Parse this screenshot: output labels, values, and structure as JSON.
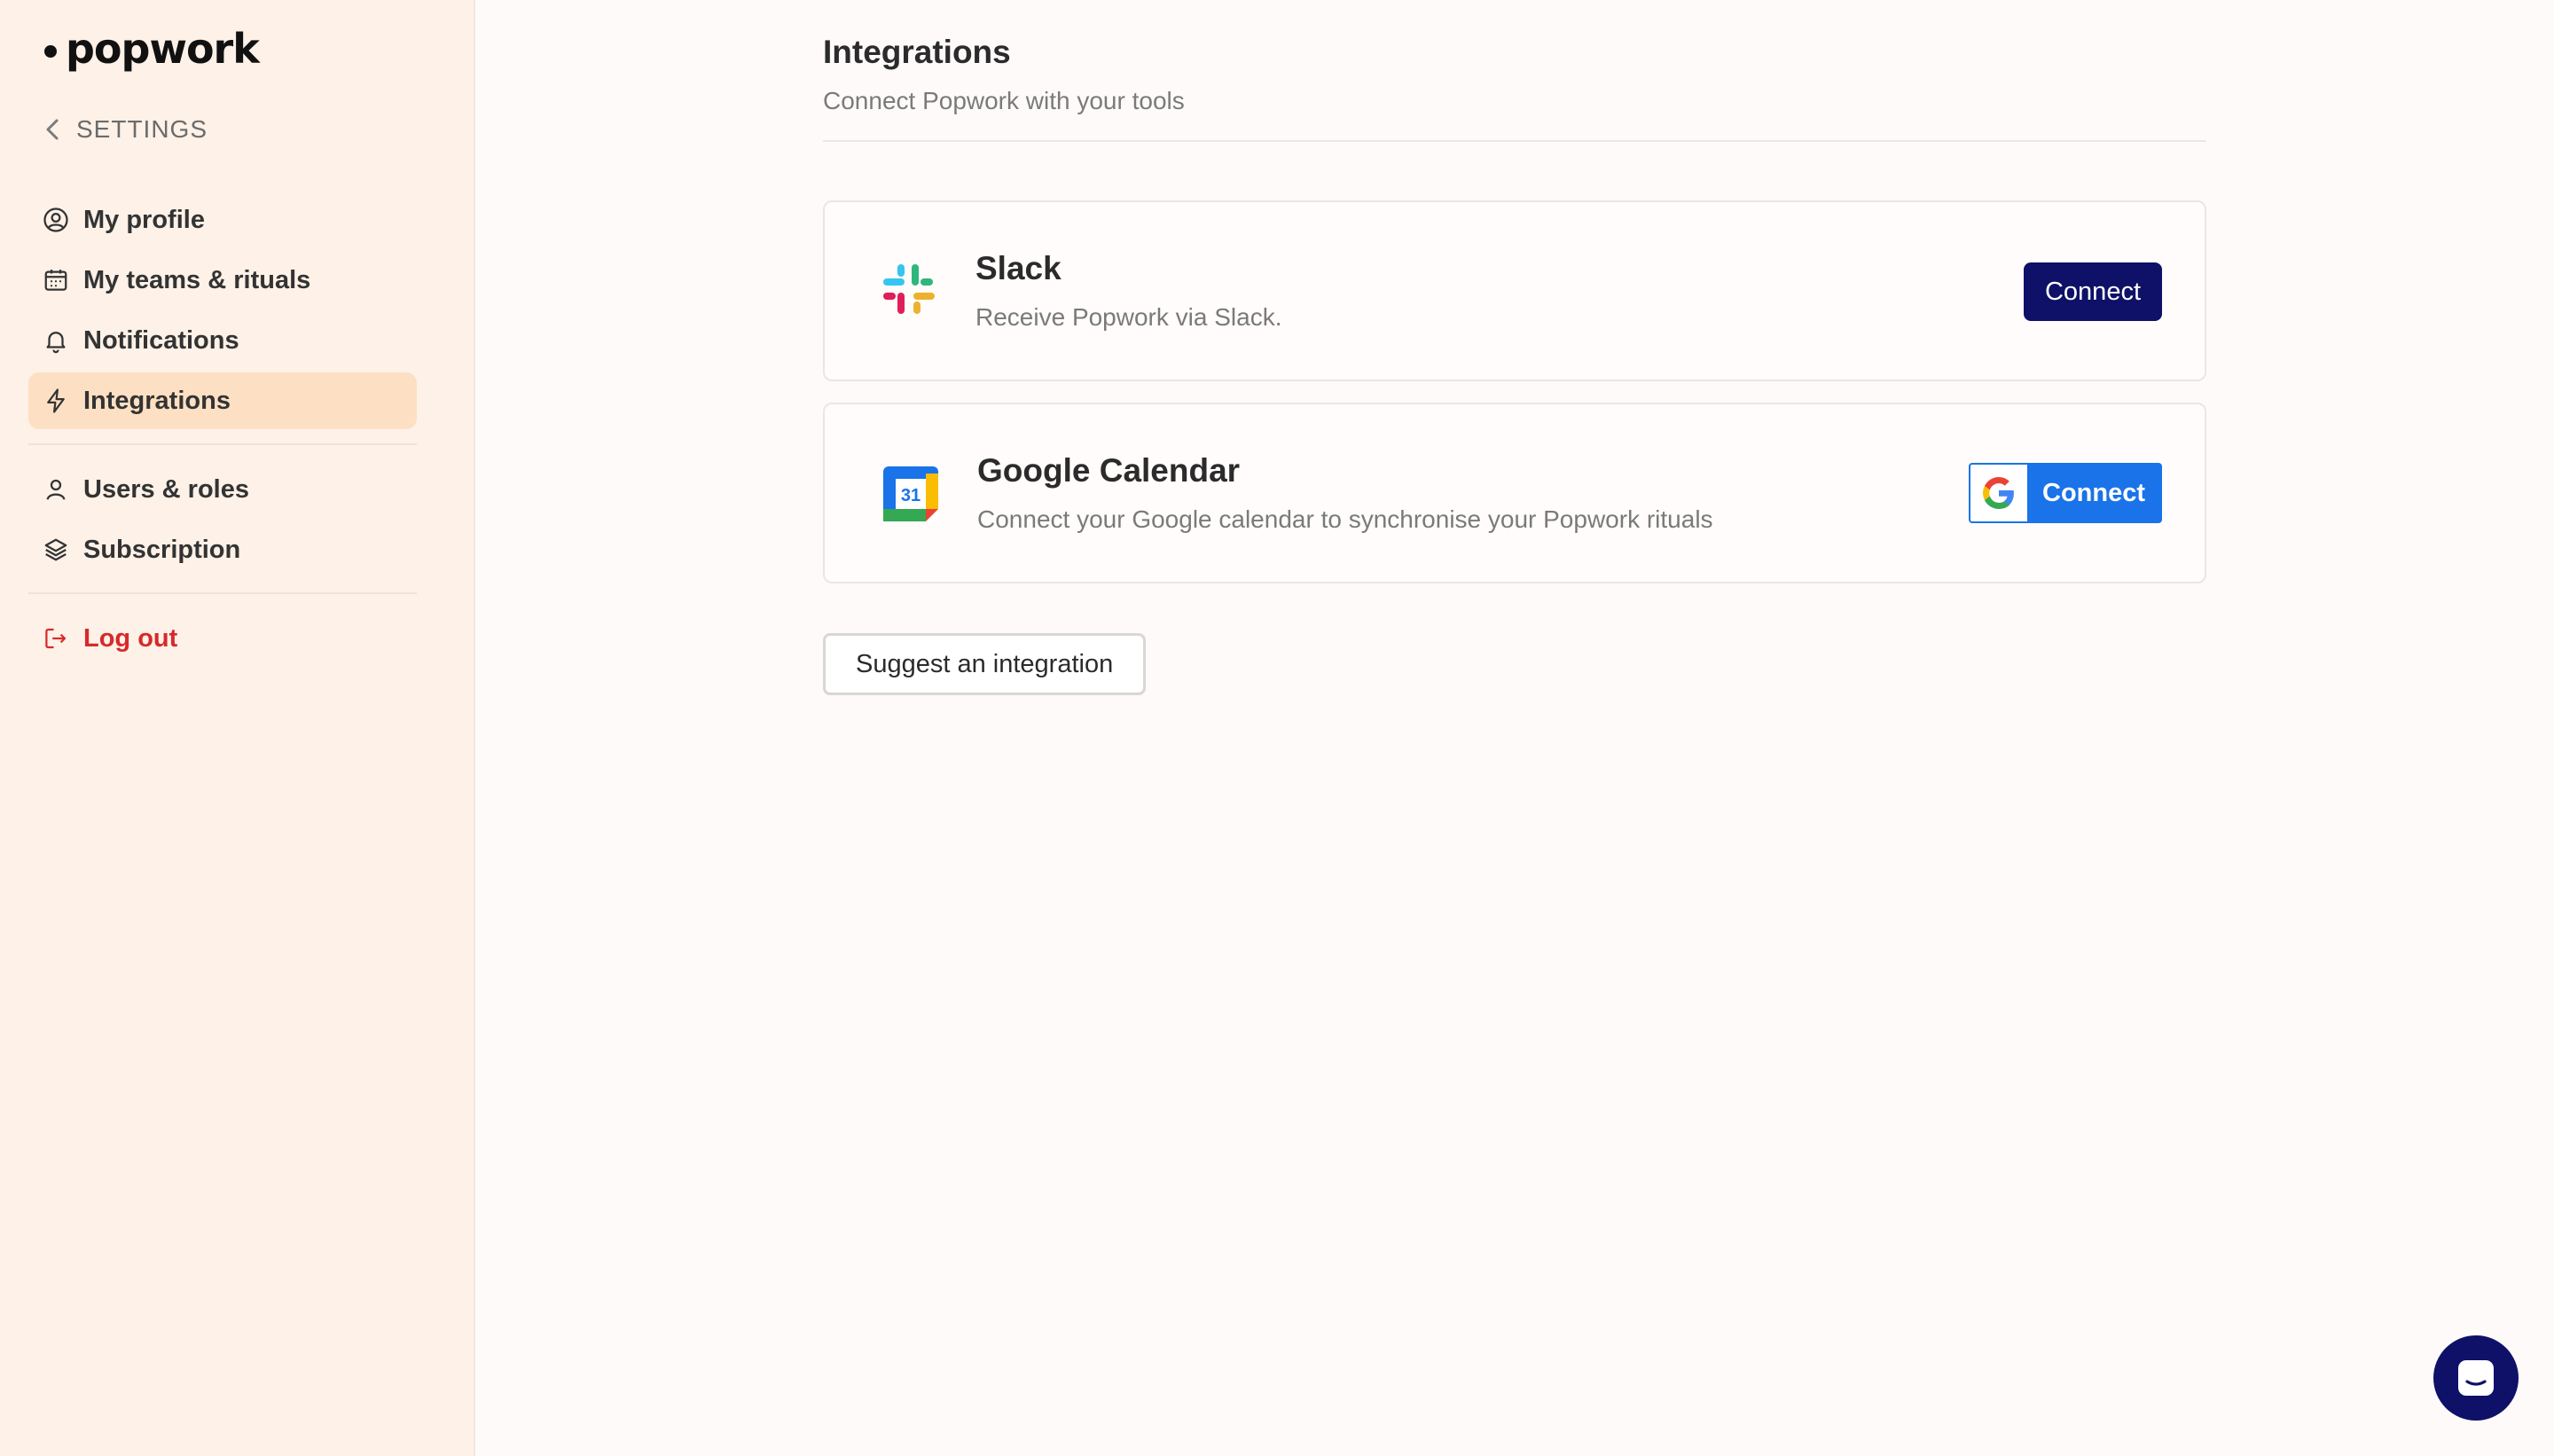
{
  "brand": {
    "name": "popwork"
  },
  "sidebar": {
    "back_label": "SETTINGS",
    "items": [
      {
        "label": "My profile",
        "icon": "user-circle-icon"
      },
      {
        "label": "My teams & rituals",
        "icon": "calendar-icon"
      },
      {
        "label": "Notifications",
        "icon": "bell-icon"
      },
      {
        "label": "Integrations",
        "icon": "lightning-icon",
        "active": true
      },
      {
        "label": "Users & roles",
        "icon": "user-icon"
      },
      {
        "label": "Subscription",
        "icon": "layers-icon"
      },
      {
        "label": "Log out",
        "icon": "logout-icon"
      }
    ]
  },
  "main": {
    "title": "Integrations",
    "subtitle": "Connect Popwork with your tools",
    "integrations": [
      {
        "name": "Slack",
        "description": "Receive Popwork via Slack.",
        "button_label": "Connect",
        "icon": "slack-logo-icon"
      },
      {
        "name": "Google Calendar",
        "description": "Connect your Google calendar to synchronise your Popwork rituals",
        "button_label": "Connect",
        "icon": "google-calendar-icon",
        "calendar_day": "31"
      }
    ],
    "suggest_label": "Suggest an integration"
  },
  "colors": {
    "sidebar_bg": "#fdf1e8",
    "active_bg": "#fde0c3",
    "primary_navy": "#0e1167",
    "google_blue": "#1a73e8",
    "logout_red": "#d62a2a"
  }
}
